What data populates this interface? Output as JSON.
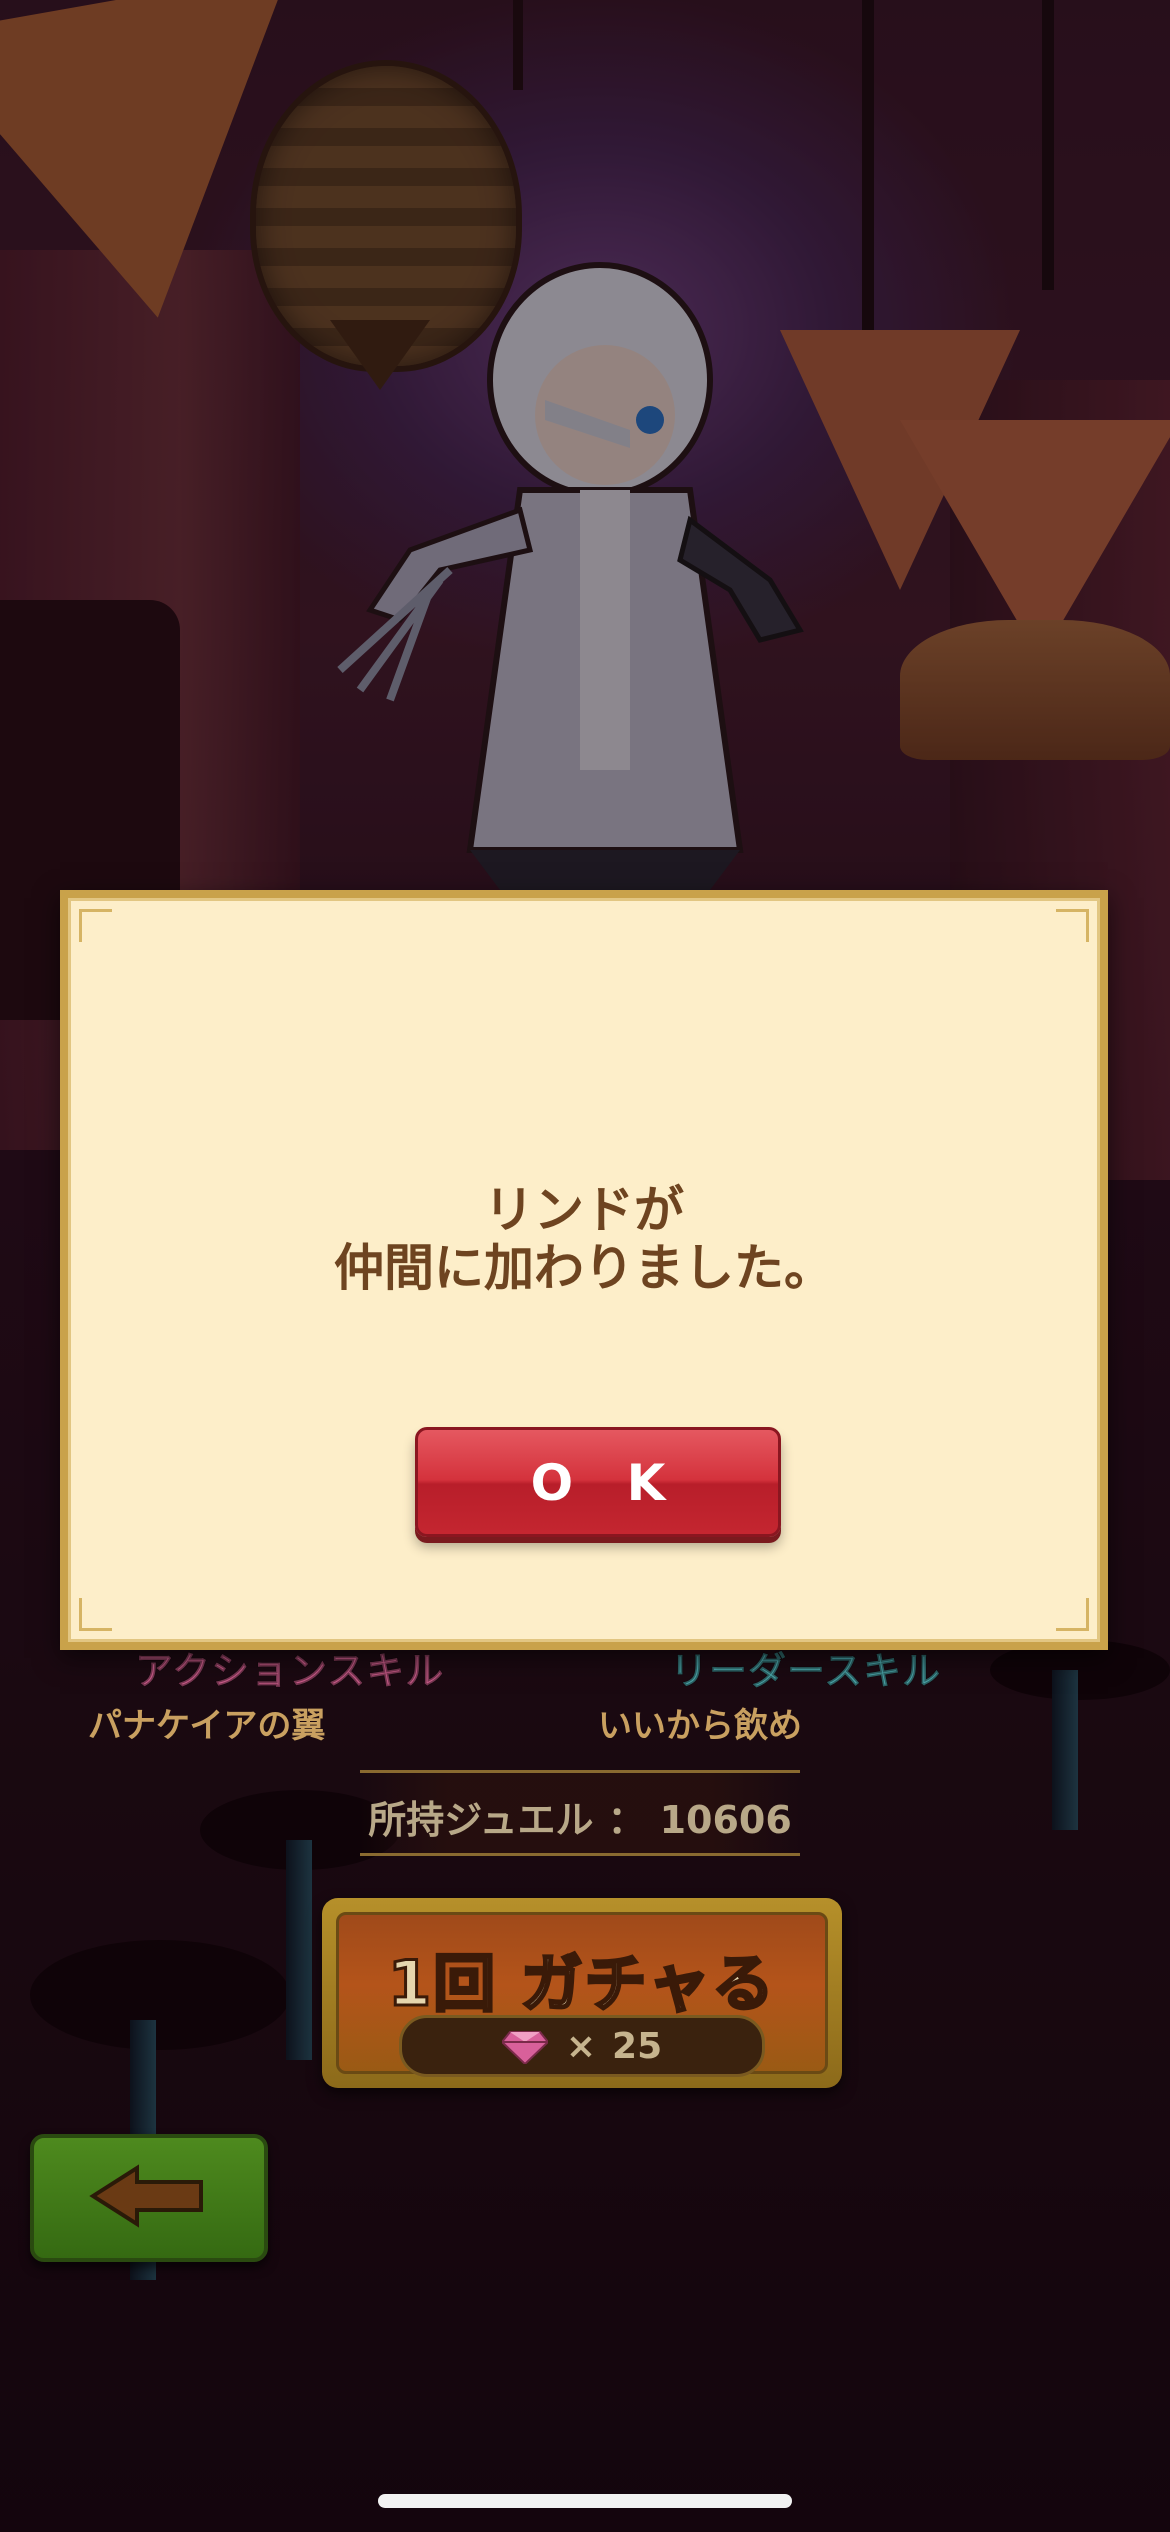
{
  "dialog": {
    "message_line1": "リンドが",
    "message_line2": "仲間に加わりました。",
    "ok_label": "O K"
  },
  "skills": {
    "action_heading": "アクションスキル",
    "action_name": "パナケイアの翼",
    "leader_heading": "リーダースキル",
    "leader_name": "いいから飲め"
  },
  "jewels": {
    "label": "所持ジュエル",
    "separator": "：",
    "count": "10606"
  },
  "gacha": {
    "label": "1回 ガチャる",
    "times": "×",
    "cost": "25"
  },
  "icons": {
    "gem": "gem-icon",
    "back": "left-arrow-icon"
  },
  "colors": {
    "dialog_bg": "#fdeec9",
    "dialog_text": "#6e4420",
    "ok_button": "#d4323c",
    "back_button": "#4e8a1e",
    "action_heading": "#c85a88",
    "leader_heading": "#4aa4a8"
  }
}
